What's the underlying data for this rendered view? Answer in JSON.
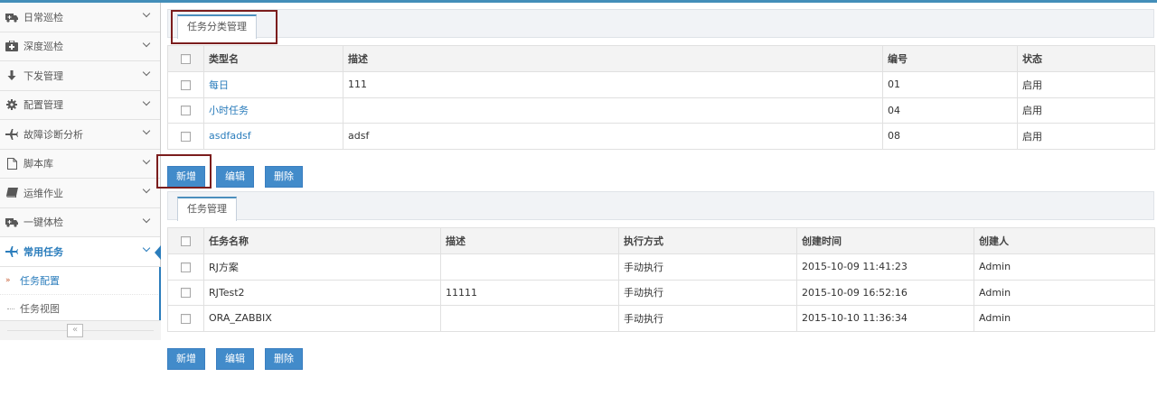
{
  "sidebar": {
    "items": [
      {
        "label": "日常巡检",
        "icon": "ambulance-icon"
      },
      {
        "label": "深度巡检",
        "icon": "medkit-icon"
      },
      {
        "label": "下发管理",
        "icon": "arrow-down-icon"
      },
      {
        "label": "配置管理",
        "icon": "gear-icon"
      },
      {
        "label": "故障诊断分析",
        "icon": "plane-icon"
      },
      {
        "label": "脚本库",
        "icon": "file-icon"
      },
      {
        "label": "运维作业",
        "icon": "book-icon"
      },
      {
        "label": "一键体检",
        "icon": "truck-icon"
      },
      {
        "label": "常用任务",
        "icon": "plane-icon"
      }
    ],
    "sub_items": [
      {
        "label": "任务配置",
        "active": true
      },
      {
        "label": "任务视图",
        "active": false
      }
    ],
    "collapse_glyph": "«"
  },
  "category_panel": {
    "tab": "任务分类管理",
    "columns": [
      "类型名",
      "描述",
      "编号",
      "状态"
    ],
    "rows": [
      [
        "每日",
        "111",
        "01",
        "启用"
      ],
      [
        "小时任务",
        "",
        "04",
        "启用"
      ],
      [
        "asdfadsf",
        "adsf",
        "08",
        "启用"
      ]
    ],
    "buttons": {
      "add": "新增",
      "edit": "编辑",
      "delete": "删除"
    }
  },
  "task_panel": {
    "tab": "任务管理",
    "columns": [
      "任务名称",
      "描述",
      "执行方式",
      "创建时间",
      "创建人"
    ],
    "rows": [
      [
        "RJ方案",
        "",
        "手动执行",
        "2015-10-09 11:41:23",
        "Admin"
      ],
      [
        "RJTest2",
        "11111",
        "手动执行",
        "2015-10-09 16:52:16",
        "Admin"
      ],
      [
        "ORA_ZABBIX",
        "",
        "手动执行",
        "2015-10-10 11:36:34",
        "Admin"
      ]
    ],
    "buttons": {
      "add": "新增",
      "edit": "编辑",
      "delete": "删除"
    }
  },
  "colors": {
    "accent": "#438eb9",
    "button": "#428bca",
    "link": "#2b7dbc",
    "highlight_box": "#7b1d1d"
  }
}
